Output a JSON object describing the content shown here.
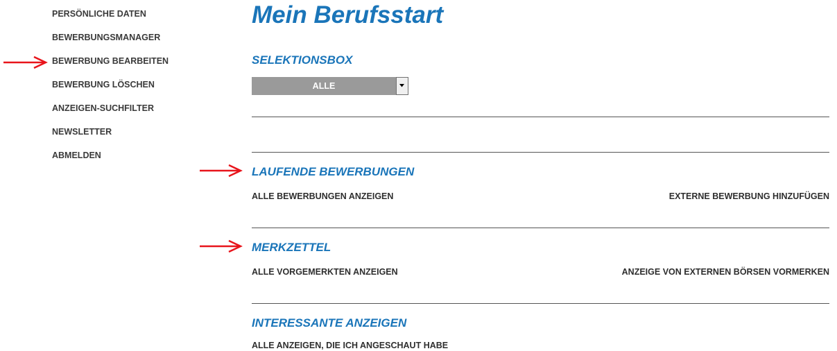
{
  "sidebar": {
    "items": [
      {
        "label": "PERSÖNLICHE DATEN"
      },
      {
        "label": "BEWERBUNGSMANAGER"
      },
      {
        "label": "BEWERBUNG BEARBEITEN"
      },
      {
        "label": "BEWERBUNG LÖSCHEN"
      },
      {
        "label": "ANZEIGEN-SUCHFILTER"
      },
      {
        "label": "NEWSLETTER"
      },
      {
        "label": "ABMELDEN"
      }
    ]
  },
  "main": {
    "title": "Mein Berufsstart",
    "selektionsbox": {
      "heading": "SELEKTIONSBOX",
      "selected": "ALLE"
    },
    "laufende": {
      "heading": "LAUFENDE BEWERBUNGEN",
      "left_link": "ALLE BEWERBUNGEN ANZEIGEN",
      "right_link": "EXTERNE BEWERBUNG HINZUFÜGEN"
    },
    "merkzettel": {
      "heading": "MERKZETTEL",
      "left_link": "ALLE VORGEMERKTEN ANZEIGEN",
      "right_link": "ANZEIGE VON EXTERNEN BÖRSEN VORMERKEN"
    },
    "interessante": {
      "heading": "INTERESSANTE ANZEIGEN",
      "left_link": "ALLE ANZEIGEN, DIE ICH ANGESCHAUT HABE"
    }
  },
  "colors": {
    "heading_blue": "#1a75b9",
    "arrow_red": "#e8141b",
    "select_gray": "#9a9a9a"
  }
}
